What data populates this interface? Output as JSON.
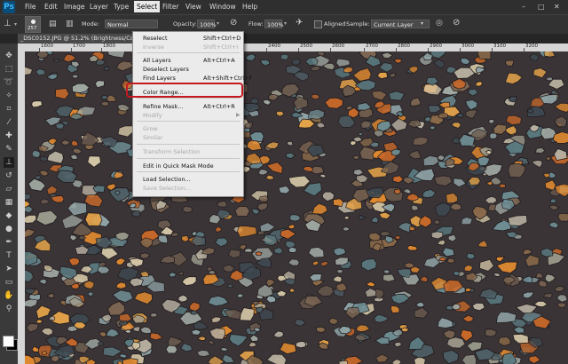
{
  "app": {
    "logo": "Ps"
  },
  "menubar": {
    "items": [
      "File",
      "Edit",
      "Image",
      "Layer",
      "Type",
      "Select",
      "Filter",
      "View",
      "Window",
      "Help"
    ],
    "active": "Select",
    "window_controls": [
      "–",
      "□",
      "✕"
    ]
  },
  "options": {
    "brush_size": "257",
    "mode_label": "Mode:",
    "mode_value": "Normal",
    "opacity_label": "Opacity:",
    "opacity_value": "100%",
    "flow_label": "Flow:",
    "flow_value": "100%",
    "aligned_label": "Aligned",
    "sample_label": "Sample:",
    "sample_value": "Current Layer"
  },
  "document": {
    "tab_title": "_DSC0152.JPG @ 51.2% (Brightness/Co"
  },
  "ruler": {
    "ticks": [
      "1600",
      "1700",
      "1800",
      "2400",
      "2500",
      "2600",
      "2700",
      "2800",
      "2900",
      "3000",
      "3100",
      "3200"
    ]
  },
  "select_menu": {
    "items": [
      {
        "label": "Reselect",
        "shortcut": "Shift+Ctrl+D",
        "enabled": true
      },
      {
        "label": "Inverse",
        "shortcut": "Shift+Ctrl+I",
        "enabled": false
      },
      {
        "label": "All Layers",
        "shortcut": "Alt+Ctrl+A",
        "enabled": true
      },
      {
        "label": "Deselect Layers",
        "shortcut": "",
        "enabled": true
      },
      {
        "label": "Find Layers",
        "shortcut": "Alt+Shift+Ctrl+F",
        "enabled": true
      },
      {
        "label": "Color Range...",
        "shortcut": "",
        "enabled": true
      },
      {
        "label": "Refine Mask...",
        "shortcut": "Alt+Ctrl+R",
        "enabled": true
      },
      {
        "label": "Modify",
        "shortcut": "",
        "enabled": false
      },
      {
        "label": "Grow",
        "shortcut": "",
        "enabled": false
      },
      {
        "label": "Similar",
        "shortcut": "",
        "enabled": false
      },
      {
        "label": "Transform Selection",
        "shortcut": "",
        "enabled": false
      },
      {
        "label": "Edit in Quick Mask Mode",
        "shortcut": "",
        "enabled": true
      },
      {
        "label": "Load Selection...",
        "shortcut": "",
        "enabled": true
      },
      {
        "label": "Save Selection...",
        "shortcut": "",
        "enabled": false
      }
    ],
    "highlighted": "Color Range..."
  },
  "tools": [
    "move-icon",
    "marquee-icon",
    "lasso-icon",
    "quick-select-icon",
    "crop-icon",
    "eyedropper-icon",
    "healing-icon",
    "brush-icon",
    "clone-stamp-icon",
    "history-brush-icon",
    "eraser-icon",
    "gradient-icon",
    "blur-icon",
    "dodge-icon",
    "pen-icon",
    "type-icon",
    "path-select-icon",
    "shape-icon",
    "hand-icon",
    "zoom-icon"
  ],
  "tool_glyphs": [
    "✥",
    "⬚",
    "➰",
    "✧",
    "⌗",
    "⁄",
    "✚",
    "✎",
    "⊥",
    "↺",
    "▱",
    "▦",
    "◆",
    "●",
    "✒",
    "T",
    "➤",
    "▭",
    "✋",
    "⚲"
  ],
  "colors": {
    "foreground": "#ffffff",
    "background": "#000000",
    "accent": "#c4191f"
  }
}
